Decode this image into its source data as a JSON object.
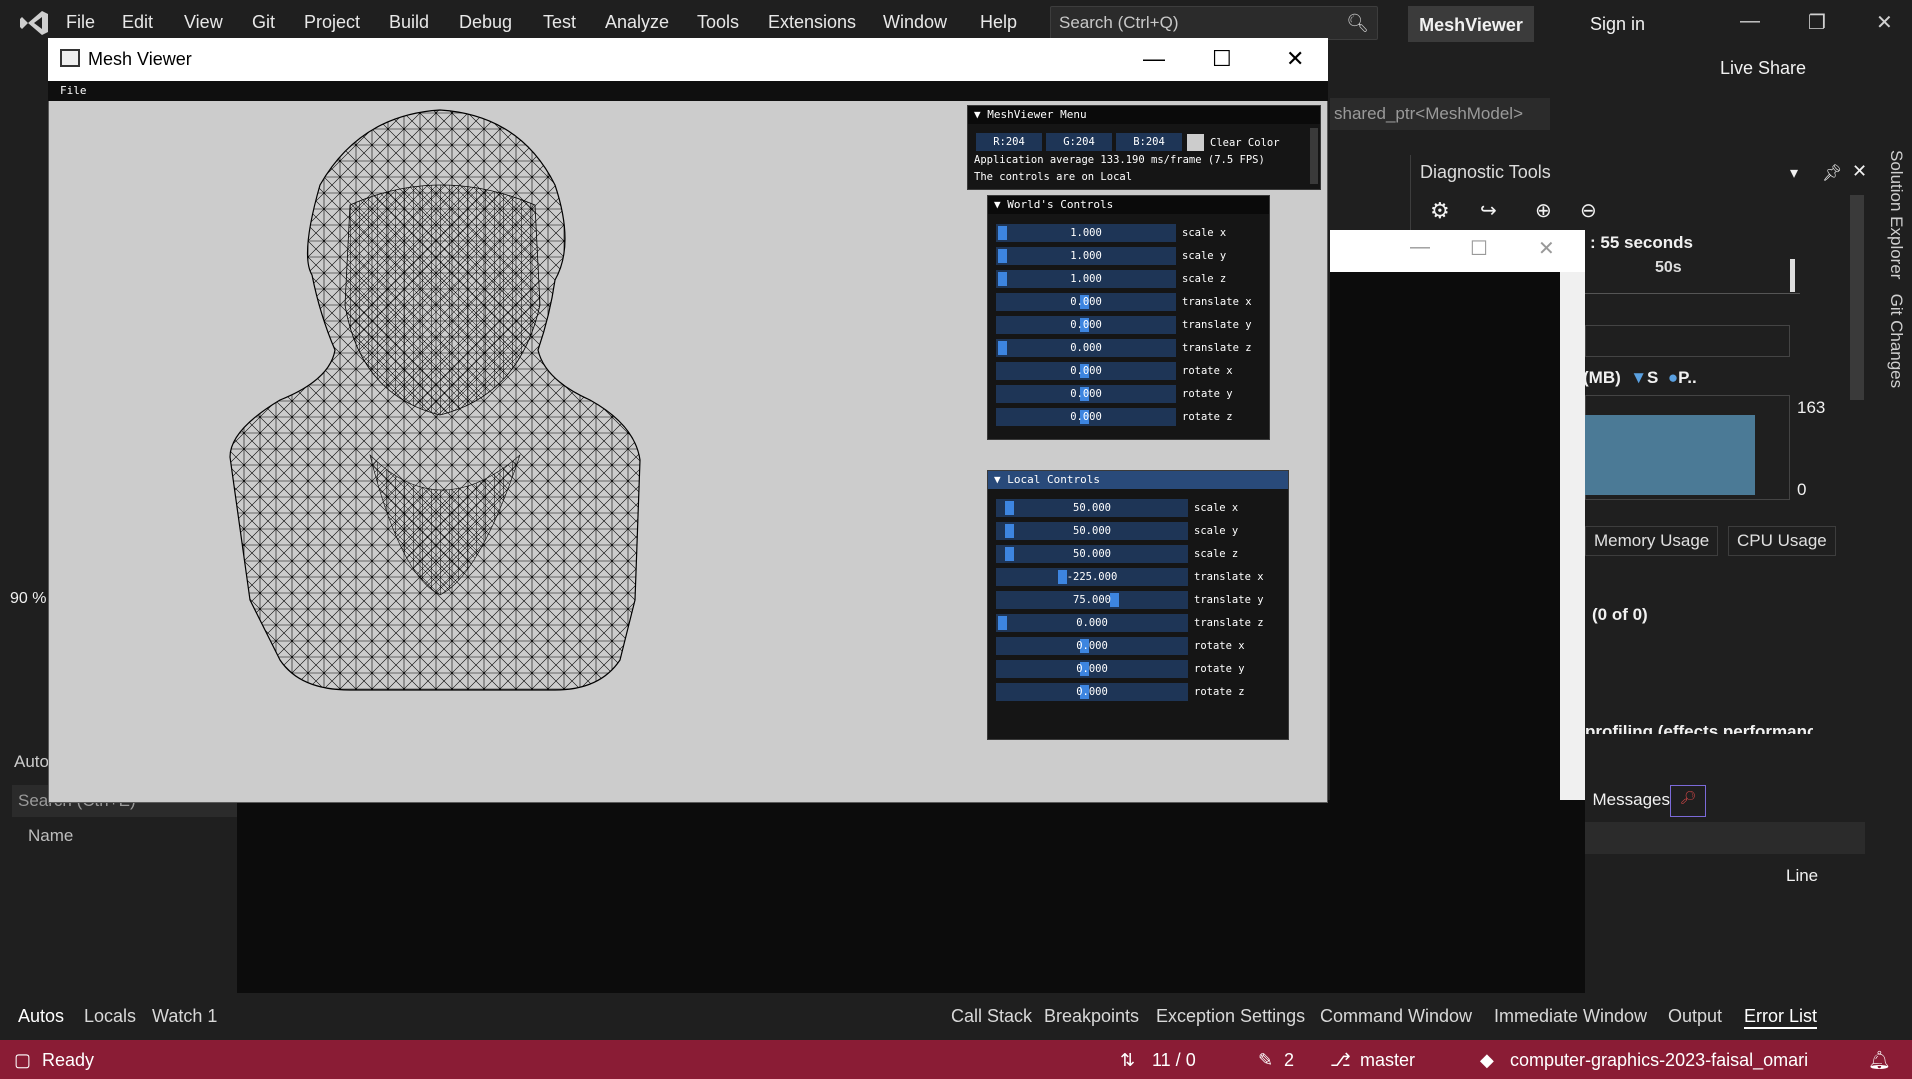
{
  "vs": {
    "menu": [
      "File",
      "Edit",
      "View",
      "Git",
      "Project",
      "Build",
      "Debug",
      "Test",
      "Analyze",
      "Tools",
      "Extensions",
      "Window",
      "Help"
    ],
    "search_placeholder": "Search (Ctrl+Q)",
    "project_name": "MeshViewer",
    "sign_in": "Sign in",
    "live_share": "Live Share",
    "toolbar_snippet": "shared_ptr<MeshModel>",
    "side_tabs": [
      "Solution Explorer",
      "Git Changes"
    ]
  },
  "diagnostics": {
    "title": "Diagnostic Tools",
    "session_suffix": ": 55 seconds",
    "timeline_label": "50s",
    "memory_label": "(MB)",
    "legend_s": "S",
    "legend_p": "P..",
    "mem_max": "163",
    "mem_min": "0",
    "tabs": [
      "Memory Usage",
      "CPU Usage"
    ],
    "of_count": "(0 of 0)",
    "profiling_text": "profiling (effects performance)"
  },
  "left_panel": {
    "zoom": "90 %",
    "autos_title": "Autos",
    "search_placeholder": "Search (Ctrl+E)",
    "name_column": "Name"
  },
  "error_panel": {
    "messages": "Messages",
    "line_column": "Line"
  },
  "bottom_tabs_left": [
    "Autos",
    "Locals",
    "Watch 1"
  ],
  "bottom_tabs_right": [
    "Call Stack",
    "Breakpoints",
    "Exception Settings",
    "Command Window",
    "Immediate Window",
    "Output",
    "Error List"
  ],
  "status": {
    "ready": "Ready",
    "line_info": "11 / 0",
    "pencil_count": "2",
    "branch": "master",
    "repo": "computer-graphics-2023-faisal_omari",
    "notif": "1"
  },
  "mesh_viewer": {
    "title": "Mesh Viewer",
    "menu_file": "File",
    "menu_window": {
      "title": "MeshViewer Menu",
      "r": "R:204",
      "g": "G:204",
      "b": "B:204",
      "clear_color": "Clear Color",
      "fps": "Application average 133.190 ms/frame (7.5 FPS)",
      "controls_on": "The controls are on Local"
    },
    "world": {
      "title": "World's Controls",
      "rows": [
        {
          "value": "1.000",
          "label": "scale x"
        },
        {
          "value": "1.000",
          "label": "scale y"
        },
        {
          "value": "1.000",
          "label": "scale z"
        },
        {
          "value": "0.000",
          "label": "translate x"
        },
        {
          "value": "0.000",
          "label": "translate y"
        },
        {
          "value": "0.000",
          "label": "translate z"
        },
        {
          "value": "0.000",
          "label": "rotate x"
        },
        {
          "value": "0.000",
          "label": "rotate y"
        },
        {
          "value": "0.000",
          "label": "rotate z"
        }
      ]
    },
    "local": {
      "title": "Local Controls",
      "rows": [
        {
          "value": "50.000",
          "label": "scale x"
        },
        {
          "value": "50.000",
          "label": "scale y"
        },
        {
          "value": "50.000",
          "label": "scale z"
        },
        {
          "value": "-225.000",
          "label": "translate x"
        },
        {
          "value": "75.000",
          "label": "translate y"
        },
        {
          "value": "0.000",
          "label": "translate z"
        },
        {
          "value": "0.000",
          "label": "rotate x"
        },
        {
          "value": "0.000",
          "label": "rotate y"
        },
        {
          "value": "0.000",
          "label": "rotate z"
        }
      ]
    }
  },
  "colors": {
    "status_bar": "#8a1c35",
    "slider": "#1e3556",
    "grab": "#3d85e0",
    "clear": "#cccccc"
  }
}
